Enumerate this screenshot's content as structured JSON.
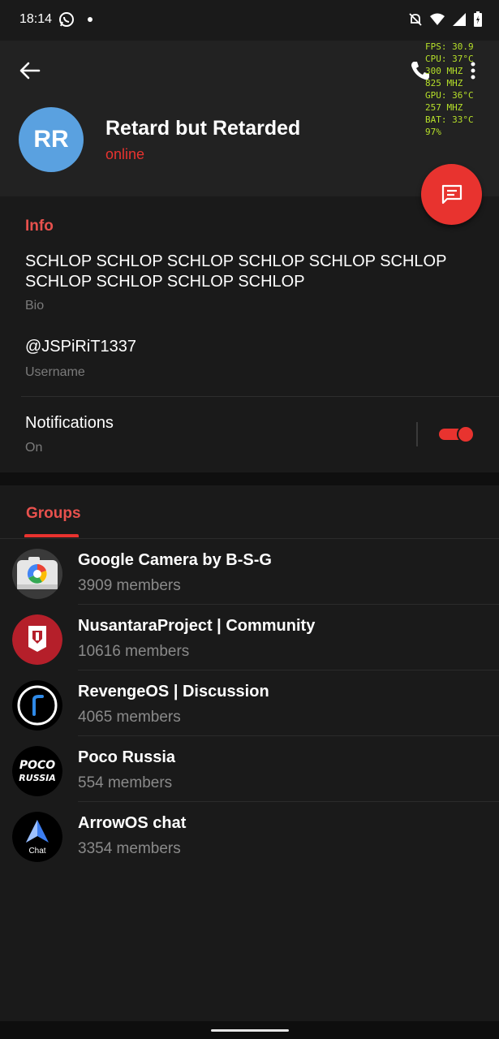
{
  "status_bar": {
    "time": "18:14",
    "icons": [
      "whatsapp-icon",
      "notification-dot",
      "bell-off-icon",
      "wifi-icon",
      "signal-icon",
      "battery-charging-icon"
    ]
  },
  "perf_overlay": {
    "lines": [
      "FPS: 30.9",
      "CPU: 37°C",
      "300 MHZ",
      "825 MHZ",
      "GPU: 36°C",
      "257 MHZ",
      "BAT: 33°C",
      "97%"
    ],
    "color": "#b6e02a"
  },
  "profile": {
    "initials": "RR",
    "name": "Retard but Retarded",
    "status": "online",
    "avatar_color": "#5aa1e0"
  },
  "info": {
    "section_title": "Info",
    "bio": "SCHLOP SCHLOP SCHLOP SCHLOP SCHLOP SCHLOP SCHLOP SCHLOP SCHLOP SCHLOP",
    "bio_label": "Bio",
    "username": "@JSPiRiT1337",
    "username_label": "Username",
    "notifications_title": "Notifications",
    "notifications_state": "On",
    "notifications_enabled": true
  },
  "groups": {
    "tab_label": "Groups",
    "items": [
      {
        "name": "Google Camera by B-S-G",
        "members": "3909 members",
        "icon": "google-camera-icon"
      },
      {
        "name": "NusantaraProject | Community",
        "members": "10616 members",
        "icon": "nusantara-icon"
      },
      {
        "name": "RevengeOS | Discussion",
        "members": "4065 members",
        "icon": "revengeos-icon"
      },
      {
        "name": "Poco Russia",
        "members": "554 members",
        "icon": "poco-russia-icon",
        "logo_line1": "POCO",
        "logo_line2": "RUSSIA"
      },
      {
        "name": "ArrowOS chat",
        "members": "3354 members",
        "icon": "arrowos-icon",
        "logo_text": "Chat"
      }
    ]
  },
  "colors": {
    "accent": "#e8332f",
    "accent_text": "#e8514d",
    "background": "#1a1a1a",
    "header": "#222222"
  }
}
